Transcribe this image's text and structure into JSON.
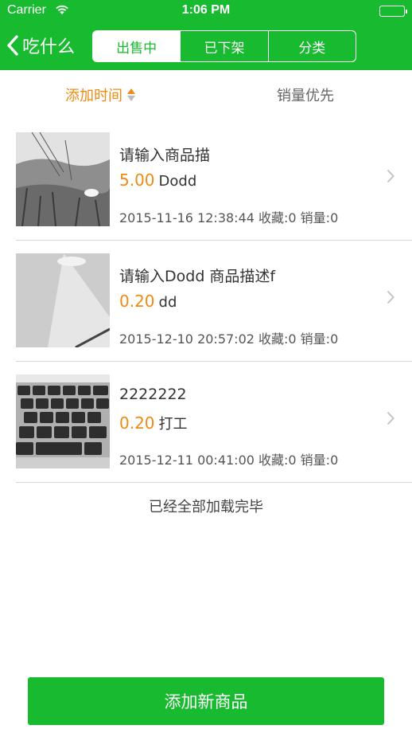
{
  "status_bar": {
    "carrier": "Carrier",
    "time": "1:06 PM",
    "wifi_icon": "wifi-icon",
    "battery_icon": "battery-icon"
  },
  "nav": {
    "back_label": "吃什么",
    "back_icon": "chevron-left-icon",
    "segments": [
      "出售中",
      "已下架",
      "分类"
    ],
    "selected_segment": "出售中"
  },
  "sort": {
    "time_label": "添加时间",
    "sales_label": "销量优先",
    "active": "添加时间"
  },
  "products": [
    {
      "name": "请输入商品描",
      "price": "5.00",
      "tag": "Dodd",
      "meta": "2015-11-16 12:38:44 收藏:0 销量:0"
    },
    {
      "name": "请输入Dodd 商品描述f",
      "price": "0.20",
      "tag": "dd",
      "meta": "2015-12-10 20:57:02 收藏:0 销量:0"
    },
    {
      "name": "2222222",
      "price": "0.20",
      "tag": "打工",
      "meta": "2015-12-11 00:41:00 收藏:0 销量:0"
    }
  ],
  "list_footer": "已经全部加载完毕",
  "add_button_label": "添加新商品",
  "colors": {
    "brand_green": "#18ba2f",
    "price_orange": "#f08a12"
  }
}
